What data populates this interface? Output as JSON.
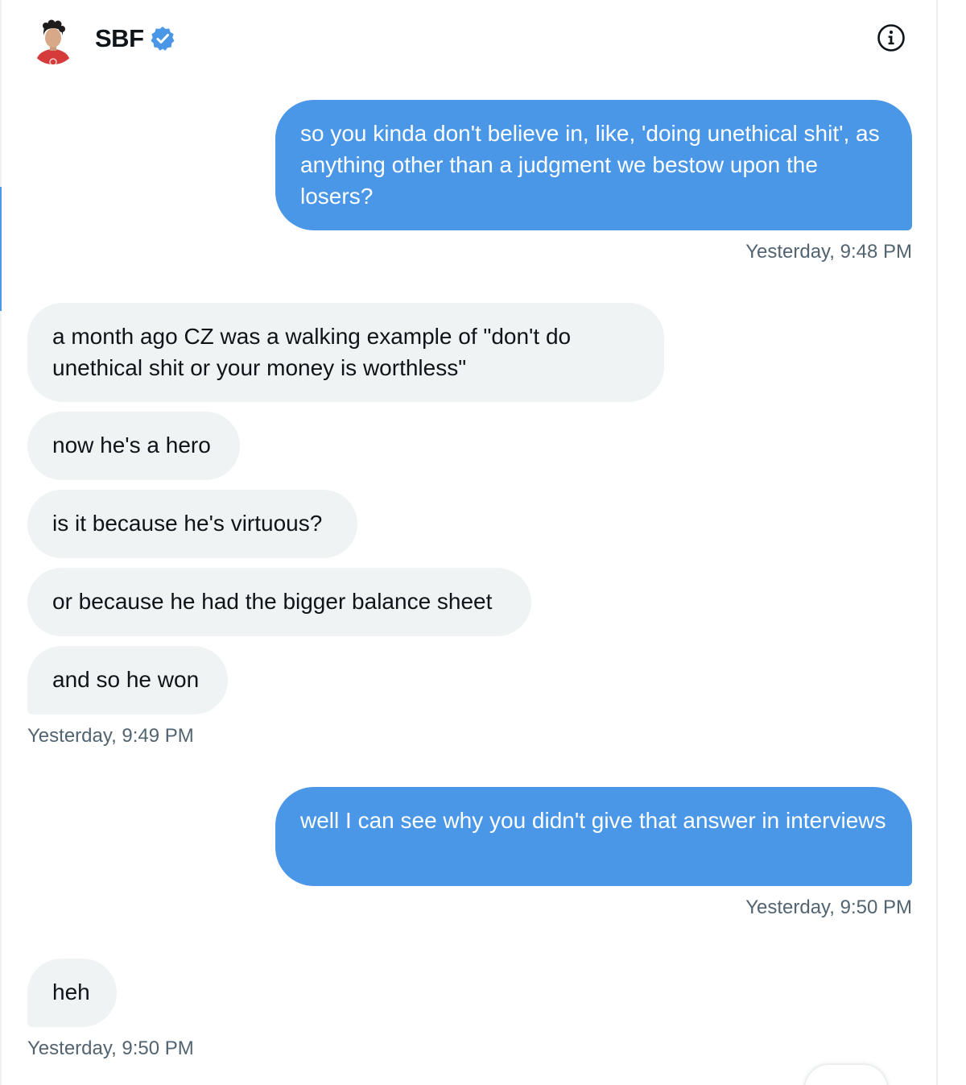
{
  "conversation": {
    "name": "SBF",
    "verified": true,
    "avatar_icon": "avatar-icon",
    "info_icon": "info-icon",
    "accent_color": "#4a97e8"
  },
  "messages": [
    {
      "direction": "sent",
      "text": "so you kinda don't believe in, like, 'doing unethical shit', as anything other than a judgment we bestow upon the losers?",
      "time": "Yesterday, 9:48 PM"
    },
    {
      "direction": "received",
      "text": "a month ago CZ was a walking example of \"don't do unethical shit or your money is worthless\""
    },
    {
      "direction": "received",
      "text": "now he's a hero"
    },
    {
      "direction": "received",
      "text": "is it because he's virtuous?"
    },
    {
      "direction": "received",
      "text": "or because he had the bigger balance sheet"
    },
    {
      "direction": "received",
      "text": "and so he won",
      "time": "Yesterday, 9:49 PM"
    },
    {
      "direction": "sent",
      "text": "well I can see why you didn't give that answer in interviews",
      "time": "Yesterday, 9:50 PM"
    },
    {
      "direction": "received",
      "text": "heh",
      "time": "Yesterday, 9:50 PM"
    }
  ]
}
